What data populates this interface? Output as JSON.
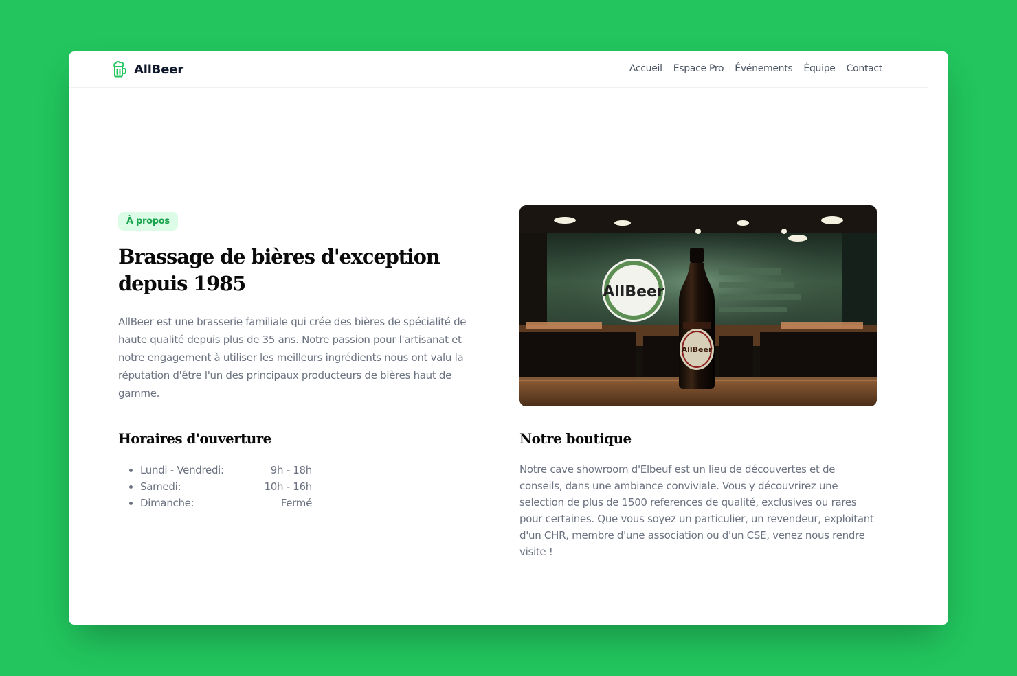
{
  "colors": {
    "background": "#22c55e",
    "accent": "#16a34a",
    "badge_bg": "#dcfce7",
    "text_muted": "#6b7280",
    "heading": "#0a0a0a"
  },
  "navbar": {
    "logo_icon": "beer-mug-icon",
    "brand": "AllBeer",
    "links": [
      "Accueil",
      "Espace Pro",
      "Événements",
      "Équipe",
      "Contact"
    ]
  },
  "about": {
    "badge": "À propos",
    "title": "Brassage de bières d'exception depuis 1985",
    "text": "AllBeer est une brasserie familiale qui crée des bières de spécialité de haute qualité depuis plus de 35 ans. Notre passion pour l'artisanat et notre engagement à utiliser les meilleurs ingrédients nous ont valu la réputation d'être l'un des principaux producteurs de bières haut de gamme."
  },
  "hours": {
    "title": "Horaires d'ouverture",
    "items": [
      {
        "day": "Lundi - Vendredi:",
        "time": "9h - 18h"
      },
      {
        "day": "Samedi:",
        "time": "10h - 16h"
      },
      {
        "day": "Dimanche:",
        "time": "Fermé"
      }
    ]
  },
  "photo": {
    "sign_text": "AllBeer",
    "bottle_label": "AllBeer"
  },
  "shop": {
    "title": "Notre boutique",
    "text": "Notre cave showroom d'Elbeuf est un lieu de découvertes et de conseils, dans une ambiance conviviale. Vous y découvrirez une selection de plus de 1500 references de qualité, exclusives ou rares pour certaines. Que vous soyez un particulier, un revendeur, exploitant d'un CHR, membre d'une association ou d'un CSE, venez nous rendre visite !"
  }
}
